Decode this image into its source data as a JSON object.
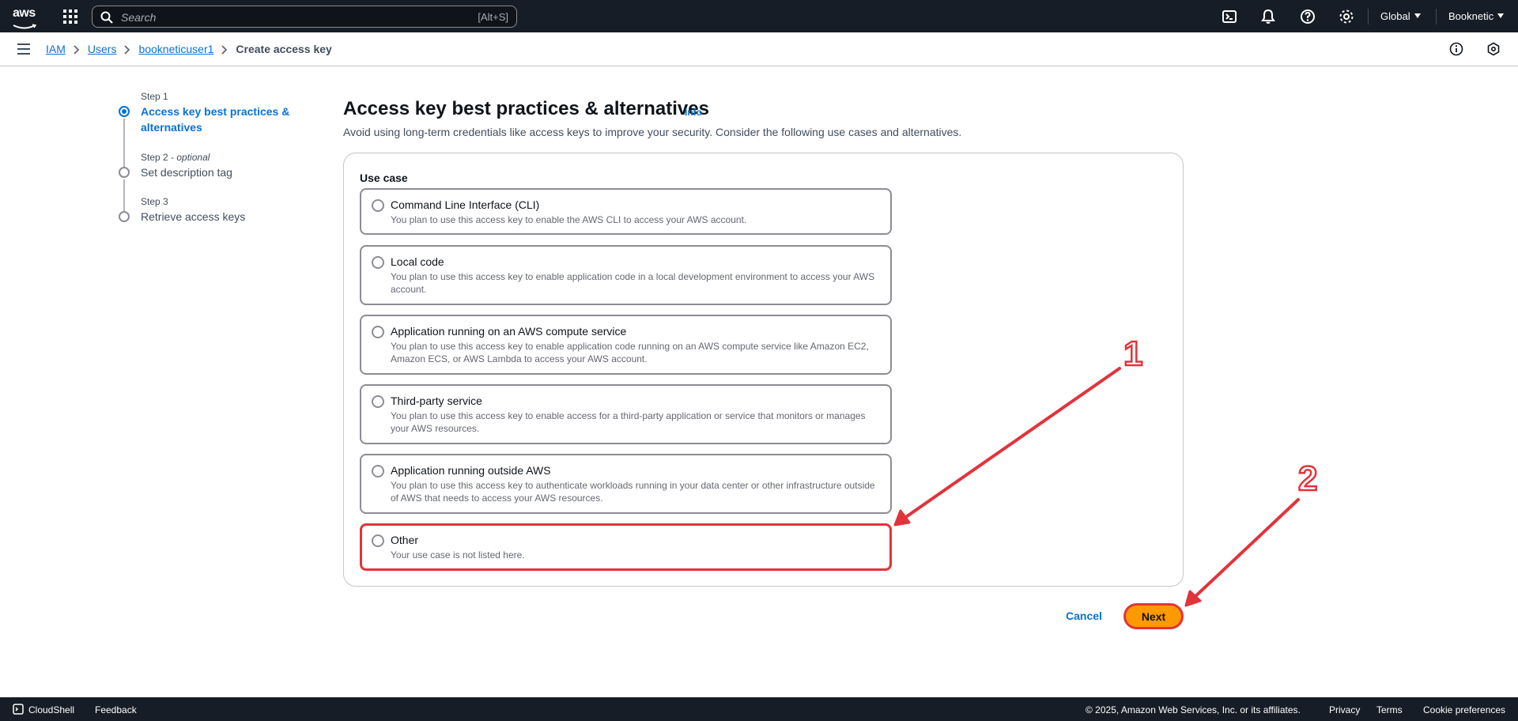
{
  "topnav": {
    "logo_text": "aws",
    "search_placeholder": "Search",
    "search_shortcut": "[Alt+S]",
    "region": "Global",
    "account": "Booknetic"
  },
  "breadcrumb": {
    "items": [
      "IAM",
      "Users",
      "bookneticuser1"
    ],
    "current": "Create access key"
  },
  "steps": [
    {
      "label": "Step 1",
      "title": "Access key best practices & alternatives",
      "optional": ""
    },
    {
      "label": "Step 2",
      "optional": "optional",
      "title": "Set description tag"
    },
    {
      "label": "Step 3",
      "title": "Retrieve access keys",
      "optional": ""
    }
  ],
  "main": {
    "title": "Access key best practices & alternatives",
    "info": "Info",
    "description": "Avoid using long-term credentials like access keys to improve your security. Consider the following use cases and alternatives.",
    "use_case_label": "Use case"
  },
  "use_cases": [
    {
      "title": "Command Line Interface (CLI)",
      "desc": "You plan to use this access key to enable the AWS CLI to access your AWS account."
    },
    {
      "title": "Local code",
      "desc": "You plan to use this access key to enable application code in a local development environment to access your AWS account."
    },
    {
      "title": "Application running on an AWS compute service",
      "desc": "You plan to use this access key to enable application code running on an AWS compute service like Amazon EC2, Amazon ECS, or AWS Lambda to access your AWS account."
    },
    {
      "title": "Third-party service",
      "desc": "You plan to use this access key to enable access for a third-party application or service that monitors or manages your AWS resources."
    },
    {
      "title": "Application running outside AWS",
      "desc": "You plan to use this access key to authenticate workloads running in your data center or other infrastructure outside of AWS that needs to access your AWS resources."
    },
    {
      "title": "Other",
      "desc": "Your use case is not listed here."
    }
  ],
  "actions": {
    "cancel": "Cancel",
    "next": "Next"
  },
  "annotations": {
    "label_1": "1",
    "label_2": "2",
    "color": "#e2333b"
  },
  "footer": {
    "cloudshell": "CloudShell",
    "feedback": "Feedback",
    "copyright": "© 2025, Amazon Web Services, Inc. or its affiliates.",
    "privacy": "Privacy",
    "terms": "Terms",
    "cookies": "Cookie preferences"
  },
  "colors": {
    "nav_bg": "#161d26",
    "link": "#0972d3",
    "primary_button": "#ff9900",
    "highlight": "#e2333b"
  }
}
